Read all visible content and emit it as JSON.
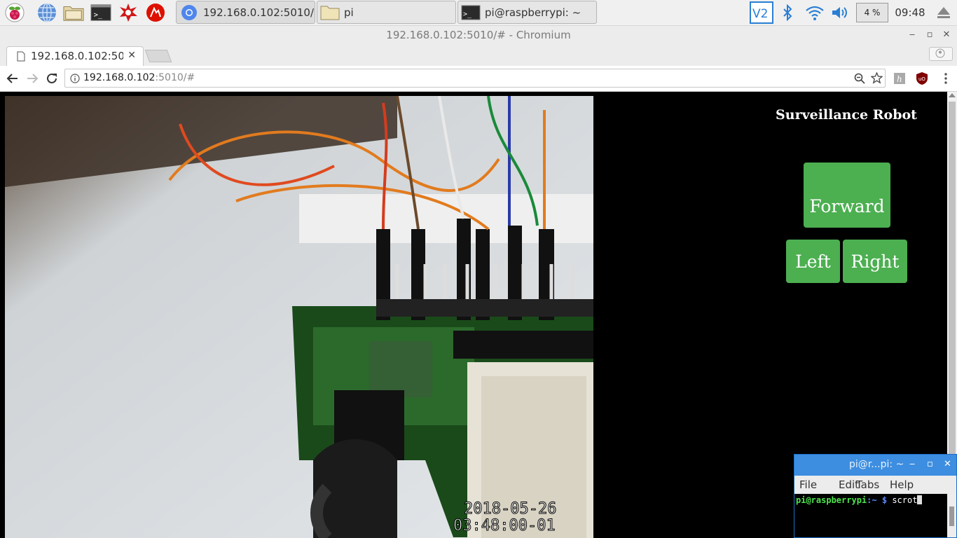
{
  "taskbar": {
    "launchers": [
      "raspberry-menu",
      "web-browser",
      "file-manager",
      "terminal",
      "mathematica",
      "wolfram"
    ],
    "tasks": [
      {
        "label": "192.168.0.102:5010/...",
        "icon": "chromium-icon"
      },
      {
        "label": "pi",
        "icon": "folder-icon"
      },
      {
        "label": "pi@raspberrypi: ~",
        "icon": "terminal-icon"
      }
    ],
    "cpu": "4 %",
    "clock": "09:48"
  },
  "window": {
    "title": "192.168.0.102:5010/# - Chromium"
  },
  "browser": {
    "tab_label": "192.168.0.102:5010/#",
    "url_host": "192.168.0.102",
    "url_path": ":5010/#"
  },
  "page": {
    "heading": "Surveillance Robot",
    "forward": "Forward",
    "left": "Left",
    "right": "Right",
    "camera_timestamp_date": "2018-05-26",
    "camera_timestamp_time": "03:48:00-01"
  },
  "terminal": {
    "title": "pi@r...pi: ~",
    "menu": [
      "File",
      "Edit",
      "Tabs",
      "Help"
    ],
    "prompt_user": "pi@raspberrypi",
    "prompt_path": ":~",
    "prompt_symbol": "$",
    "command": "scrot"
  },
  "colors": {
    "button_green": "#4caf50",
    "terminal_title_blue": "#3d8ee0",
    "prompt_green": "#4ce64c",
    "prompt_blue": "#5b8cff"
  }
}
